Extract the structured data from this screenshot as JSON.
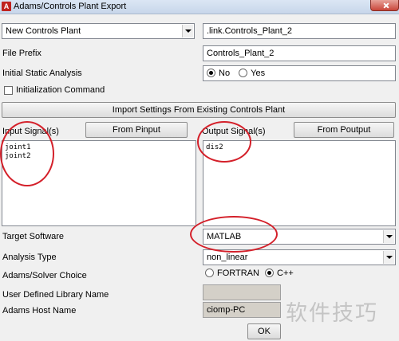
{
  "window": {
    "title": "Adams/Controls Plant Export",
    "icon_letter": "A"
  },
  "plant_selector": {
    "value": "New Controls Plant"
  },
  "plant_path": {
    "value": ".link.Controls_Plant_2"
  },
  "file_prefix": {
    "label": "File Prefix",
    "value": "Controls_Plant_2"
  },
  "initial_static_analysis": {
    "label": "Initial Static Analysis",
    "options": [
      "No",
      "Yes"
    ],
    "selected": "No"
  },
  "initialization_command": {
    "label": "Initialization Command",
    "checked": false
  },
  "import_button": {
    "label": "Import Settings From Existing Controls Plant"
  },
  "input_signals": {
    "label": "Input Signal(s)",
    "button": "From Pinput",
    "items": [
      "joint1",
      "joint2"
    ]
  },
  "output_signals": {
    "label": "Output Signal(s)",
    "button": "From Poutput",
    "items": [
      "dis2"
    ]
  },
  "target_software": {
    "label": "Target Software",
    "value": "MATLAB"
  },
  "analysis_type": {
    "label": "Analysis Type",
    "value": "non_linear"
  },
  "solver_choice": {
    "label": "Adams/Solver Choice",
    "options": [
      "FORTRAN",
      "C++"
    ],
    "selected": "C++"
  },
  "user_library": {
    "label": "User Defined Library Name",
    "value": ""
  },
  "host_name": {
    "label": "Adams Host Name",
    "value": "ciomp-PC"
  },
  "ok_button": {
    "label": "OK"
  },
  "watermark": "软件技巧",
  "annotation_color": "#d4202a"
}
